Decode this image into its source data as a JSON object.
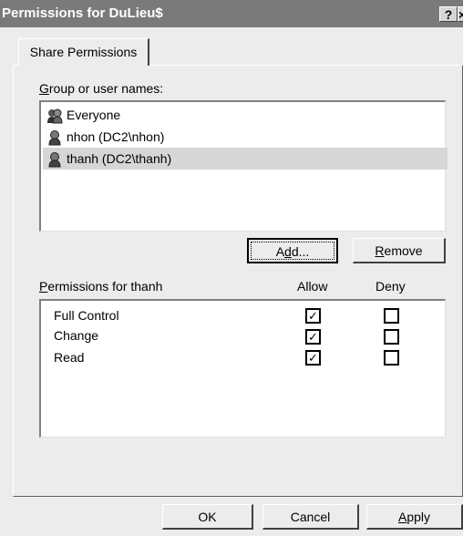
{
  "window": {
    "title": "Permissions for DuLieu$",
    "help_label": "?",
    "close_label": "×"
  },
  "tab": {
    "label": "Share Permissions"
  },
  "group_section": {
    "label_accel": "G",
    "label_rest": "roup or user names:",
    "users": [
      {
        "name": "Everyone",
        "icon": "group-icon"
      },
      {
        "name": "nhon (DC2\\nhon)",
        "icon": "user-icon"
      },
      {
        "name": "thanh (DC2\\thanh)",
        "icon": "user-icon",
        "selected": true
      }
    ],
    "add_accel_pre": "A",
    "add_accel": "d",
    "add_rest": "d...",
    "remove_accel": "R",
    "remove_rest": "emove"
  },
  "permissions_section": {
    "label_accel": "P",
    "label_rest": "ermissions for thanh",
    "allow_header": "Allow",
    "deny_header": "Deny",
    "rows": [
      {
        "name": "Full Control",
        "allow": true,
        "deny": false
      },
      {
        "name": "Change",
        "allow": true,
        "deny": false
      },
      {
        "name": "Read",
        "allow": true,
        "deny": false
      }
    ]
  },
  "buttons": {
    "ok": "OK",
    "cancel": "Cancel",
    "apply_accel": "A",
    "apply_rest": "pply"
  },
  "check_glyph": "✓"
}
